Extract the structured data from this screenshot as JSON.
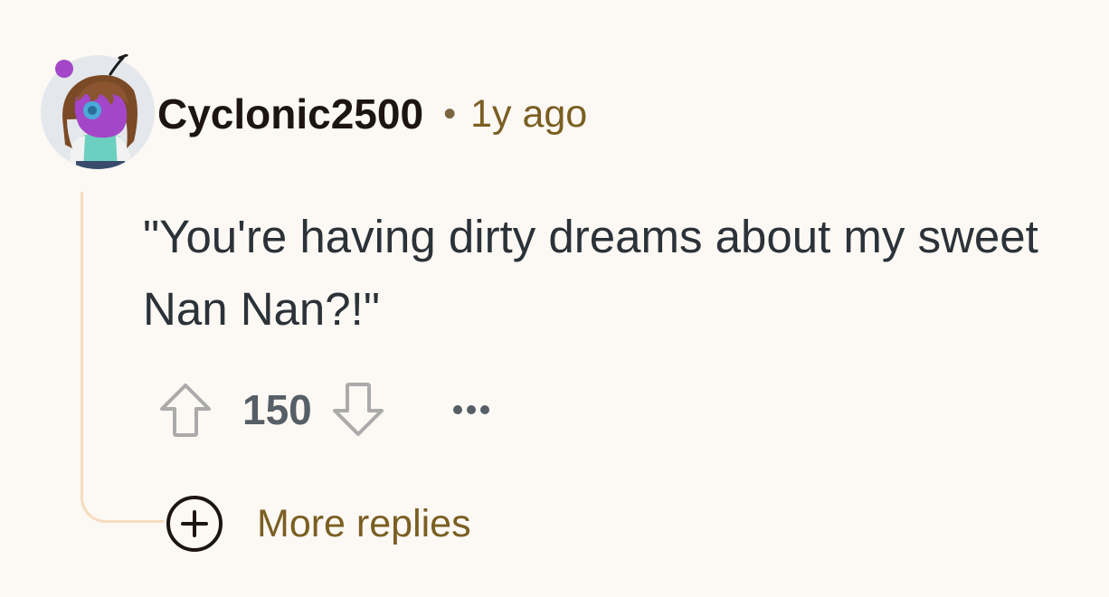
{
  "comment": {
    "username": "Cyclonic2500",
    "separator": "•",
    "timestamp": "1y ago",
    "text": "\"You're having dirty dreams about my sweet Nan Nan?!\"",
    "vote_count": "150",
    "avatar_icon": "user-avatar-icon",
    "upvote_icon": "arrow-up-icon",
    "downvote_icon": "arrow-down-icon",
    "more_icon": "ellipsis-icon"
  },
  "replies": {
    "more_label": "More replies",
    "expand_icon": "plus-circle-icon"
  },
  "colors": {
    "background": "#fcf8f4",
    "thread_line": "#f6dcbd",
    "username": "#1c1510",
    "timestamp": "#7a5f22",
    "body_text": "#2b3238",
    "vote_count": "#565e66",
    "icon_gray": "#aaaaaa",
    "avatar_purple": "#9a3fc4"
  }
}
